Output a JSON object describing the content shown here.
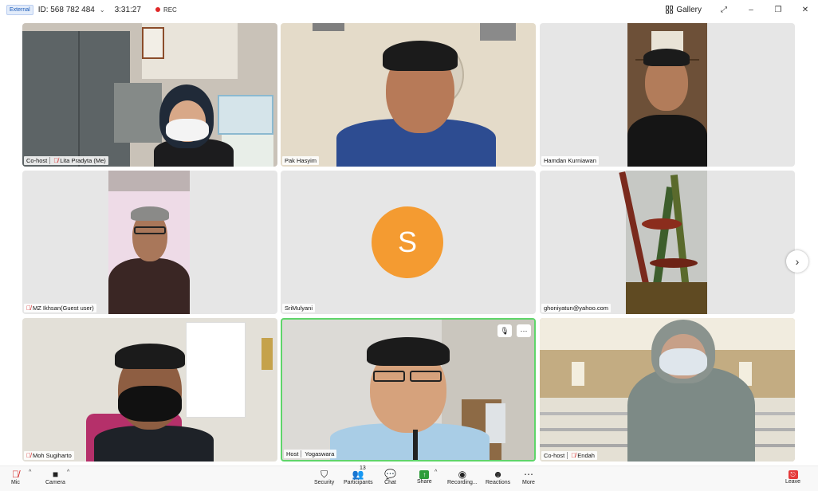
{
  "topbar": {
    "badge": "External",
    "meeting_id": "ID: 568 782 484",
    "timer": "3:31:27",
    "rec": "REC",
    "gallery": "Gallery"
  },
  "tiles": [
    {
      "name": "Lita Pradyta (Me)",
      "role": "Co-host",
      "muted": true
    },
    {
      "name": "Pak Hasyim"
    },
    {
      "name": "Hamdan Kurniawan"
    },
    {
      "name": "MZ Ikhsan(Guest user)",
      "muted": true
    },
    {
      "name": "SriMulyani",
      "avatar_letter": "S"
    },
    {
      "name": "ghoniyatun@yahoo.com"
    },
    {
      "name": "Moh Sugiharto",
      "muted": true
    },
    {
      "name": "Yogaswara",
      "role": "Host",
      "speaking": true
    },
    {
      "name": "Endah",
      "role": "Co-host",
      "muted": true
    }
  ],
  "toolbar": {
    "mic": "Mic",
    "camera": "Camera",
    "security": "Security",
    "participants": "Participants",
    "participants_count": "13",
    "chat": "Chat",
    "share": "Share",
    "recording": "Recording...",
    "reactions": "Reactions",
    "more": "More",
    "leave": "Leave"
  },
  "colors": {
    "speaking_border": "#5fd56a",
    "avatar_bg": "#f49b31",
    "rec_dot": "#e02828",
    "share_green": "#2f9e3b",
    "leave_red": "#e53b3b"
  }
}
